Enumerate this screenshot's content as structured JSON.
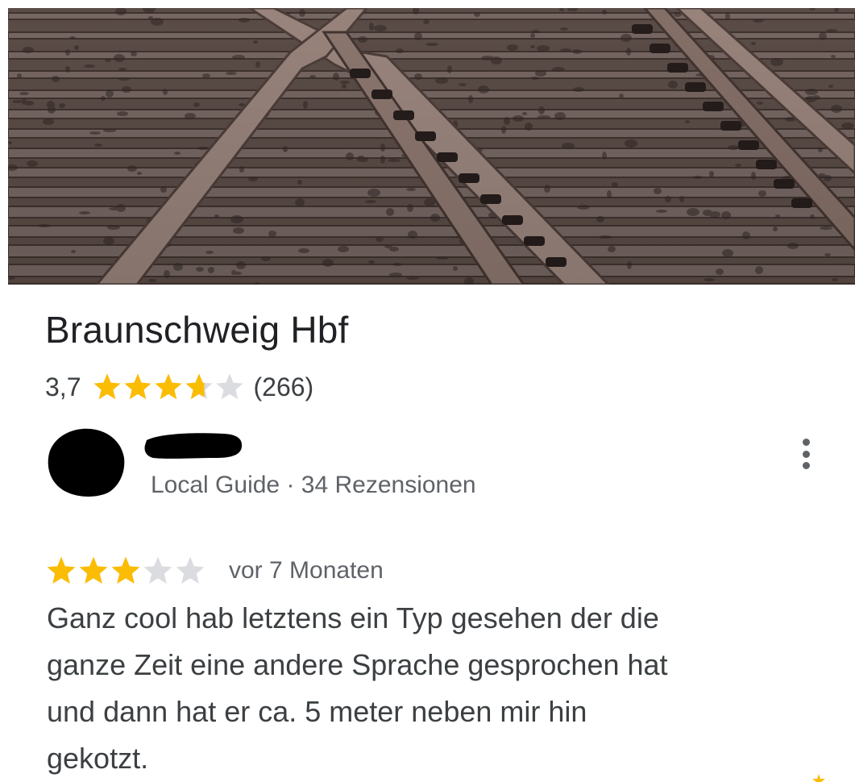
{
  "place": {
    "name": "Braunschweig Hbf",
    "rating": "3,7",
    "rating_value": 3.7,
    "review_count": "(266)"
  },
  "review": {
    "reviewer_meta": "Local Guide · 34 Rezensionen",
    "stars": 3,
    "date": "vor 7 Monaten",
    "text_lines": [
      "Ganz cool hab letztens ein Typ gesehen der die",
      "ganze Zeit eine andere Sprache gesprochen hat",
      "und dann hat er ca. 5 meter neben mir hin",
      "gekotzt."
    ]
  },
  "icons": {
    "star": "star-icon",
    "more": "more-vert-icon"
  },
  "colors": {
    "star_filled": "#FBBC04",
    "star_empty": "#DADCE0",
    "title_text": "#202124",
    "secondary_text": "#5F6368",
    "body_text": "#3C4043"
  }
}
